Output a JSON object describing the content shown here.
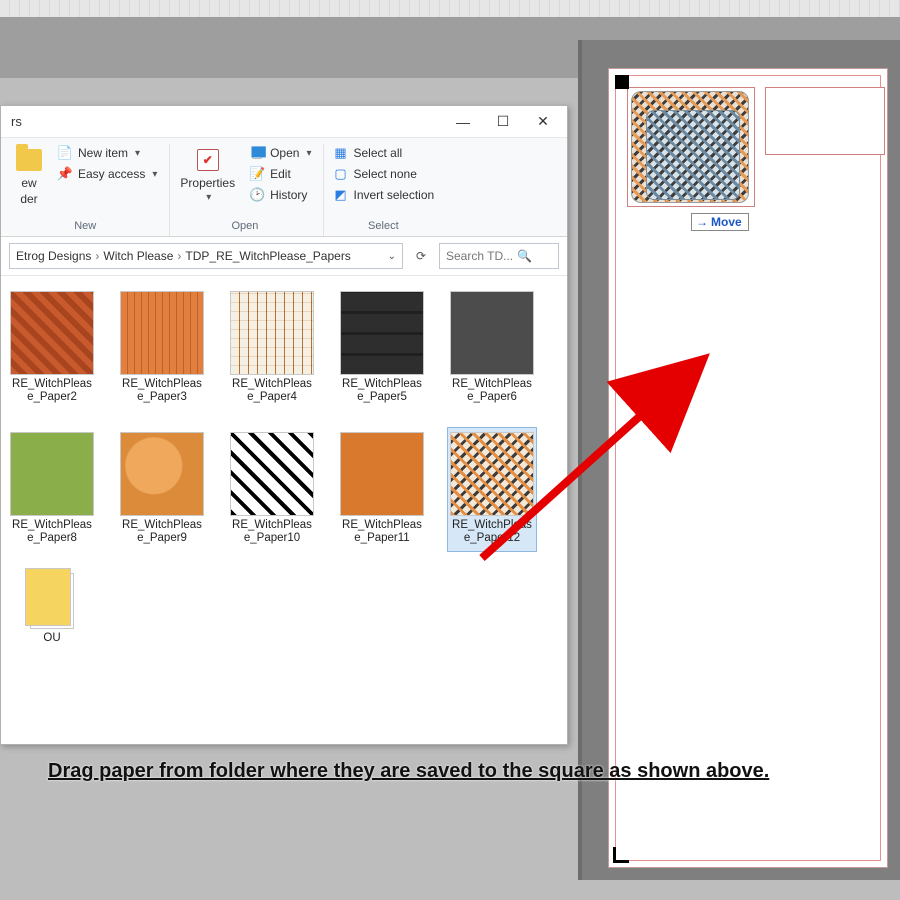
{
  "titlebar": {
    "fragment": "rs"
  },
  "window_controls": {
    "help": "?"
  },
  "ribbon": {
    "new_group": {
      "new_folder_sub": "ew",
      "new_folder_sub2": "der",
      "new_item": "New item",
      "easy_access": "Easy access",
      "label": "New"
    },
    "open_group": {
      "properties": "Properties",
      "open": "Open",
      "edit": "Edit",
      "history": "History",
      "label": "Open"
    },
    "select_group": {
      "select_all": "Select all",
      "select_none": "Select none",
      "invert": "Invert selection",
      "label": "Select"
    }
  },
  "breadcrumbs": {
    "seg1": "Etrog Designs",
    "seg2": "Witch Please",
    "seg3": "TDP_RE_WitchPlease_Papers"
  },
  "search": {
    "placeholder": "Search TD..."
  },
  "files": [
    {
      "name": "RE_WitchPlease_Paper2",
      "cls": "t2"
    },
    {
      "name": "RE_WitchPlease_Paper3",
      "cls": "t3"
    },
    {
      "name": "RE_WitchPlease_Paper4",
      "cls": "t4"
    },
    {
      "name": "RE_WitchPlease_Paper5",
      "cls": "t5"
    },
    {
      "name": "RE_WitchPlease_Paper6",
      "cls": "t6"
    },
    {
      "name": "RE_WitchPlease_Paper8",
      "cls": "t8"
    },
    {
      "name": "RE_WitchPlease_Paper9",
      "cls": "t9"
    },
    {
      "name": "RE_WitchPlease_Paper10",
      "cls": "t10"
    },
    {
      "name": "RE_WitchPlease_Paper11",
      "cls": "t11"
    },
    {
      "name": "RE_WitchPlease_Paper12",
      "cls": "t12",
      "selected": true
    }
  ],
  "extra_file": {
    "name": "OU"
  },
  "drag": {
    "move_label": "Move"
  },
  "instruction": "Drag paper from folder where they are saved to the square as shown above."
}
